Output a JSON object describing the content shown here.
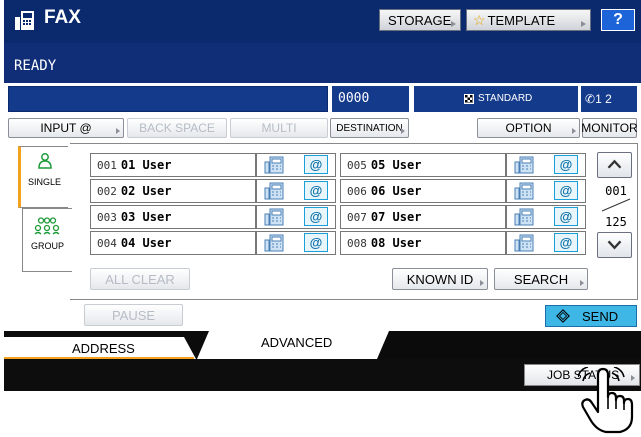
{
  "header": {
    "title": "FAX",
    "storage_label": "STORAGE",
    "template_label": "TEMPLATE",
    "help_label": "?"
  },
  "status": {
    "message": "READY",
    "counter": "0000",
    "resolution": "STANDARD",
    "lines": "1 2"
  },
  "toolbar": {
    "input_label": "INPUT @",
    "backspace_label": "BACK SPACE",
    "multi_label": "MULTI",
    "destination_label": "DESTINATION",
    "option_label": "OPTION",
    "monitor_label": "MONITOR"
  },
  "side_tabs": {
    "single_label": "SINGLE",
    "group_label": "GROUP"
  },
  "entries": [
    {
      "num": "001",
      "name": "01 User"
    },
    {
      "num": "002",
      "name": "02 User"
    },
    {
      "num": "003",
      "name": "03 User"
    },
    {
      "num": "004",
      "name": "04 User"
    },
    {
      "num": "005",
      "name": "05 User"
    },
    {
      "num": "006",
      "name": "06 User"
    },
    {
      "num": "007",
      "name": "07 User"
    },
    {
      "num": "008",
      "name": "08 User"
    }
  ],
  "pager": {
    "current": "001",
    "total": "125"
  },
  "actions": {
    "all_clear_label": "ALL CLEAR",
    "known_id_label": "KNOWN ID",
    "search_label": "SEARCH",
    "pause_label": "PAUSE",
    "send_label": "SEND"
  },
  "bottom_tabs": {
    "address_label": "ADDRESS",
    "advanced_label": "ADVANCED",
    "job_status_label": "JOB STATUS"
  },
  "icons": {
    "fax": "fax-icon",
    "star": "star-icon",
    "phone": "phone-icon",
    "email": "at-icon",
    "send": "diamond-icon",
    "hand": "pointer-hand-icon"
  },
  "colors": {
    "title_bar": "#0b2a6e",
    "accent_orange": "#f4a21c",
    "send_blue": "#3eb7e6",
    "help_blue": "#1c64d8"
  }
}
